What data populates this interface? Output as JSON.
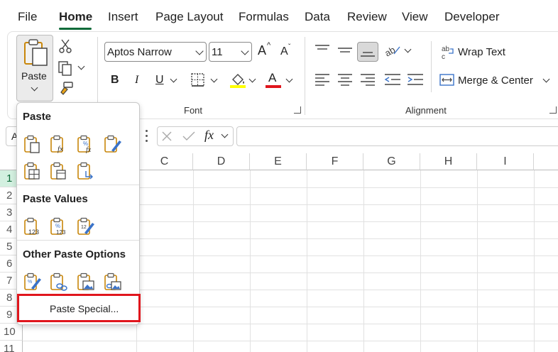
{
  "menu": {
    "tabs": [
      "File",
      "Home",
      "Insert",
      "Page Layout",
      "Formulas",
      "Data",
      "Review",
      "View",
      "Developer"
    ],
    "active": "Home"
  },
  "ribbon": {
    "clipboard": {
      "paste_label": "Paste"
    },
    "font": {
      "font_name": "Aptos Narrow",
      "font_size": "11",
      "increase_label": "A",
      "decrease_label": "A",
      "bold": "B",
      "italic": "I",
      "underline": "U",
      "font_color_letter": "A",
      "group_label": "Font",
      "highlight_color": "#ffff00",
      "font_color": "#e0161d"
    },
    "alignment": {
      "wrap_text": "Wrap Text",
      "merge_center": "Merge & Center",
      "group_label": "Alignment"
    }
  },
  "formula_bar": {
    "name_box": "A",
    "fx": "fx",
    "value": ""
  },
  "grid": {
    "columns": [
      "C",
      "D",
      "E",
      "F",
      "G",
      "H",
      "I"
    ],
    "rows": [
      "1",
      "2",
      "3",
      "4",
      "5",
      "6",
      "7",
      "8",
      "9",
      "10",
      "11"
    ],
    "selected_row": "1",
    "selection_color": "#0f6b3a"
  },
  "paste_menu": {
    "section_paste": "Paste",
    "section_values": "Paste Values",
    "section_other": "Other Paste Options",
    "paste_special": "Paste Special...",
    "highlight_color": "#e0161d",
    "paste_icons": [
      "paste-icon",
      "paste-formulas-icon",
      "paste-formulas-number-format-icon",
      "paste-keep-source-formatting-icon",
      "paste-no-borders-icon",
      "paste-keep-column-widths-icon",
      "paste-transpose-icon"
    ],
    "values_icons": [
      "paste-values-icon",
      "paste-values-number-format-icon",
      "paste-values-source-formatting-icon"
    ],
    "other_icons": [
      "paste-formatting-icon",
      "paste-link-icon",
      "paste-picture-icon",
      "paste-linked-picture-icon"
    ]
  }
}
